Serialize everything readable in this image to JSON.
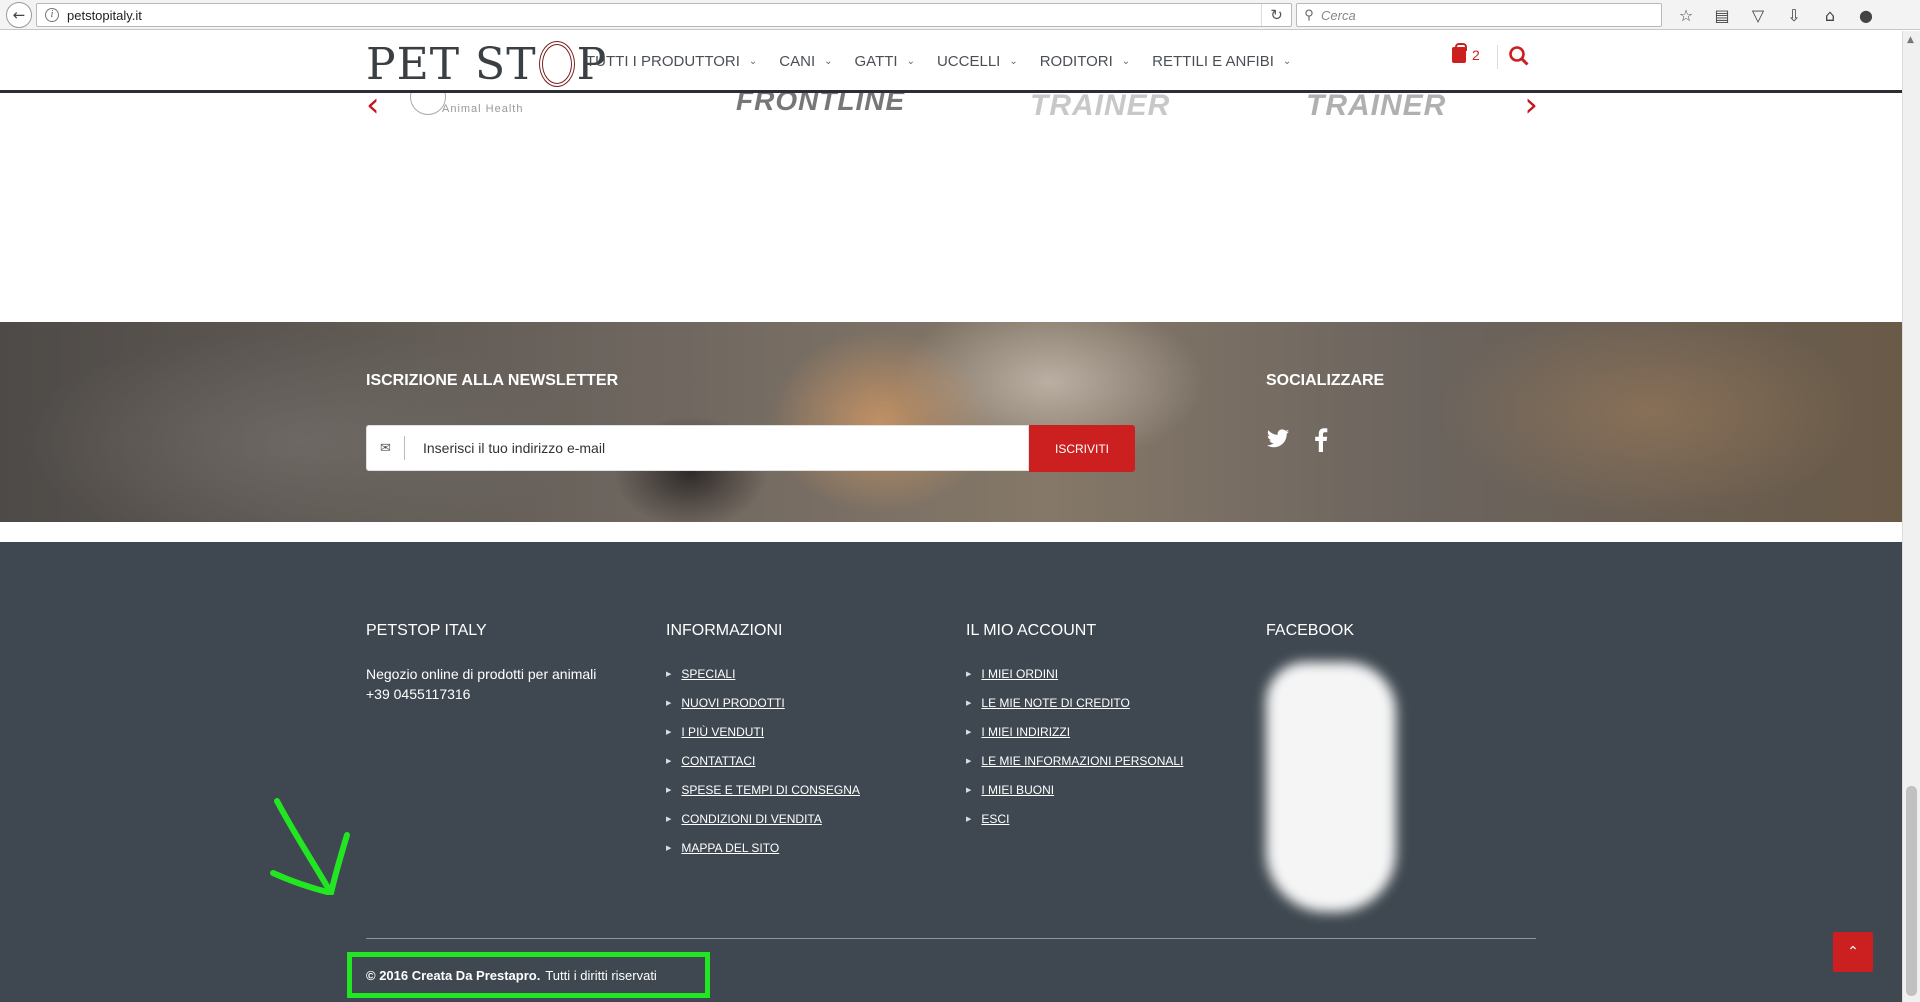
{
  "browser": {
    "url": "petstopitaly.it",
    "search_placeholder": "Cerca",
    "toolbar_icons": [
      "star-icon",
      "reading-list-icon",
      "pocket-icon",
      "download-icon",
      "home-icon",
      "chat-icon",
      "menu-icon"
    ]
  },
  "header": {
    "logo_left": "PET ST",
    "logo_right": "P",
    "nav": [
      {
        "label": "TUTTI I PRODUTTORI"
      },
      {
        "label": "CANI"
      },
      {
        "label": "GATTI"
      },
      {
        "label": "UCCELLI"
      },
      {
        "label": "RODITORI"
      },
      {
        "label": "RETTILI E ANFIBI"
      }
    ],
    "cart_count": "2"
  },
  "carousel": {
    "brands": [
      "Animal Health",
      "FRONTLINE",
      "TRAINER",
      "TRAINER"
    ]
  },
  "newsletter": {
    "title": "ISCRIZIONE ALLA NEWSLETTER",
    "email_placeholder": "Inserisci il tuo indirizzo e-mail",
    "button_label": "ISCRIVITI",
    "social_title": "SOCIALIZZARE"
  },
  "footer": {
    "about": {
      "title": "PETSTOP ITALY",
      "description": "Negozio online di prodotti per animali",
      "phone": "+39 0455117316"
    },
    "info": {
      "title": "INFORMAZIONI",
      "links": [
        "SPECIALI",
        "NUOVI PRODOTTI",
        "I PIÙ VENDUTI",
        "CONTATTACI",
        "SPESE E TEMPI DI CONSEGNA",
        "CONDIZIONI DI VENDITA",
        "MAPPA DEL SITO"
      ]
    },
    "account": {
      "title": "IL MIO ACCOUNT",
      "links": [
        "I MIEI ORDINI",
        "LE MIE NOTE DI CREDITO",
        "I MIEI INDIRIZZI",
        "LE MIE INFORMAZIONI PERSONALI",
        "I MIEI BUONI",
        "ESCI"
      ]
    },
    "facebook": {
      "title": "FACEBOOK"
    },
    "copyright_bold": "© 2016 Creata Da Prestapro.",
    "copyright_rest": "Tutti i diritti riservati"
  },
  "colors": {
    "accent": "#cc1f1f",
    "footer_bg": "#3f4850",
    "highlight": "#22e622"
  }
}
